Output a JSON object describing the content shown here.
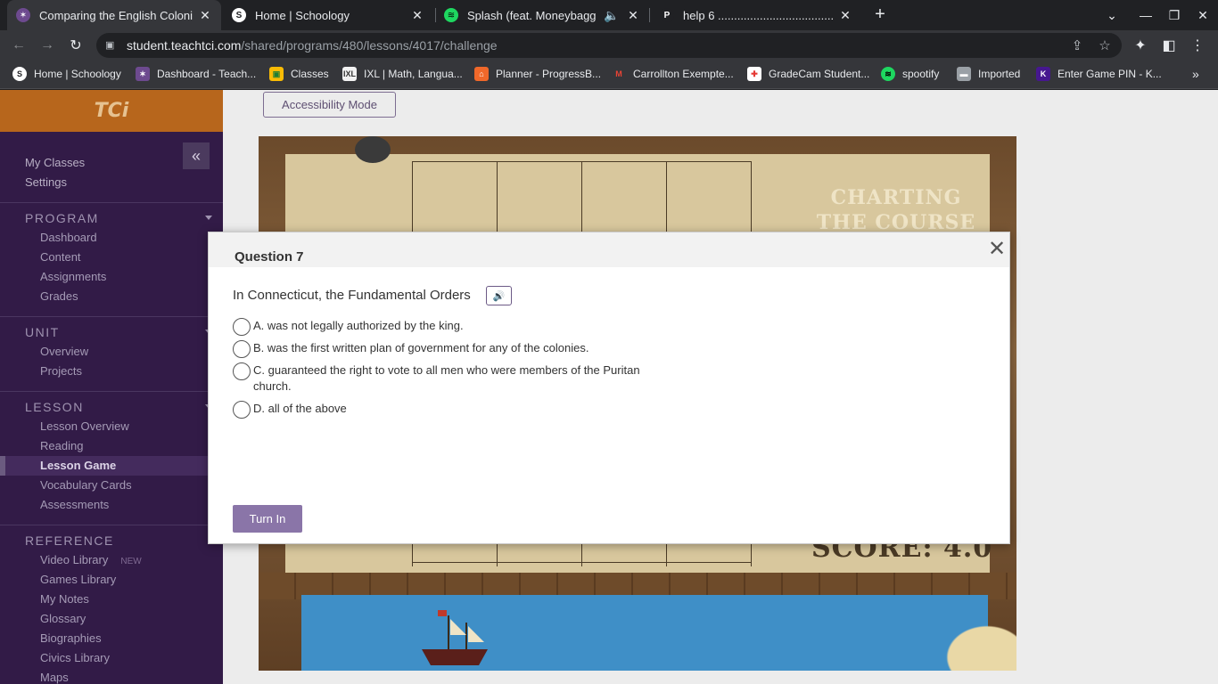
{
  "browser": {
    "tabs": [
      {
        "title": "Comparing the English Colonies",
        "favicon": "tci-favicon"
      },
      {
        "title": "Home | Schoology",
        "favicon": "schoology-favicon"
      },
      {
        "title": "Splash (feat. Moneybagg Yo",
        "favicon": "spotify-favicon"
      },
      {
        "title": "help 6 ................................................",
        "favicon": "p-favicon"
      }
    ],
    "url_host": "student.teachtci.com",
    "url_path": "/shared/programs/480/lessons/4017/challenge",
    "bookmarks": [
      "Home | Schoology",
      "Dashboard - Teach...",
      "Classes",
      "IXL | Math, Langua...",
      "Planner - ProgressB...",
      "Carrollton Exempte...",
      "GradeCam Student...",
      "spootify",
      "Imported",
      "Enter Game PIN - K..."
    ]
  },
  "sidebar": {
    "logo": "TCi",
    "top_links": [
      "My Classes",
      "Settings"
    ],
    "sections": {
      "program": {
        "title": "PROGRAM",
        "items": [
          "Dashboard",
          "Content",
          "Assignments",
          "Grades"
        ]
      },
      "unit": {
        "title": "UNIT",
        "items": [
          "Overview",
          "Projects"
        ]
      },
      "lesson": {
        "title": "LESSON",
        "items": [
          "Lesson Overview",
          "Reading",
          "Lesson Game",
          "Vocabulary Cards",
          "Assessments"
        ]
      },
      "reference": {
        "title": "REFERENCE",
        "items": [
          "Video Library",
          "Games Library",
          "My Notes",
          "Glossary",
          "Biographies",
          "Civics Library",
          "Maps"
        ],
        "new_badge": "NEW"
      }
    }
  },
  "content": {
    "accessibility_label": "Accessibility Mode",
    "game": {
      "title_line1": "CHARTING",
      "title_line2": "THE COURSE",
      "score_text": "SCORE:  4.0"
    }
  },
  "modal": {
    "title": "Question 7",
    "prompt": "In Connecticut, the Fundamental Orders",
    "options": [
      "A. was not legally authorized by the king.",
      "B. was the first written plan of government for any of the colonies.",
      "C. guaranteed the right to vote to all men who were members of the Puritan church.",
      "D. all of the above"
    ],
    "submit_label": "Turn In"
  },
  "colors": {
    "sidebar_bg": "#321b47",
    "sidebar_header": "#b7661c",
    "accent_purple": "#8a75a8"
  }
}
